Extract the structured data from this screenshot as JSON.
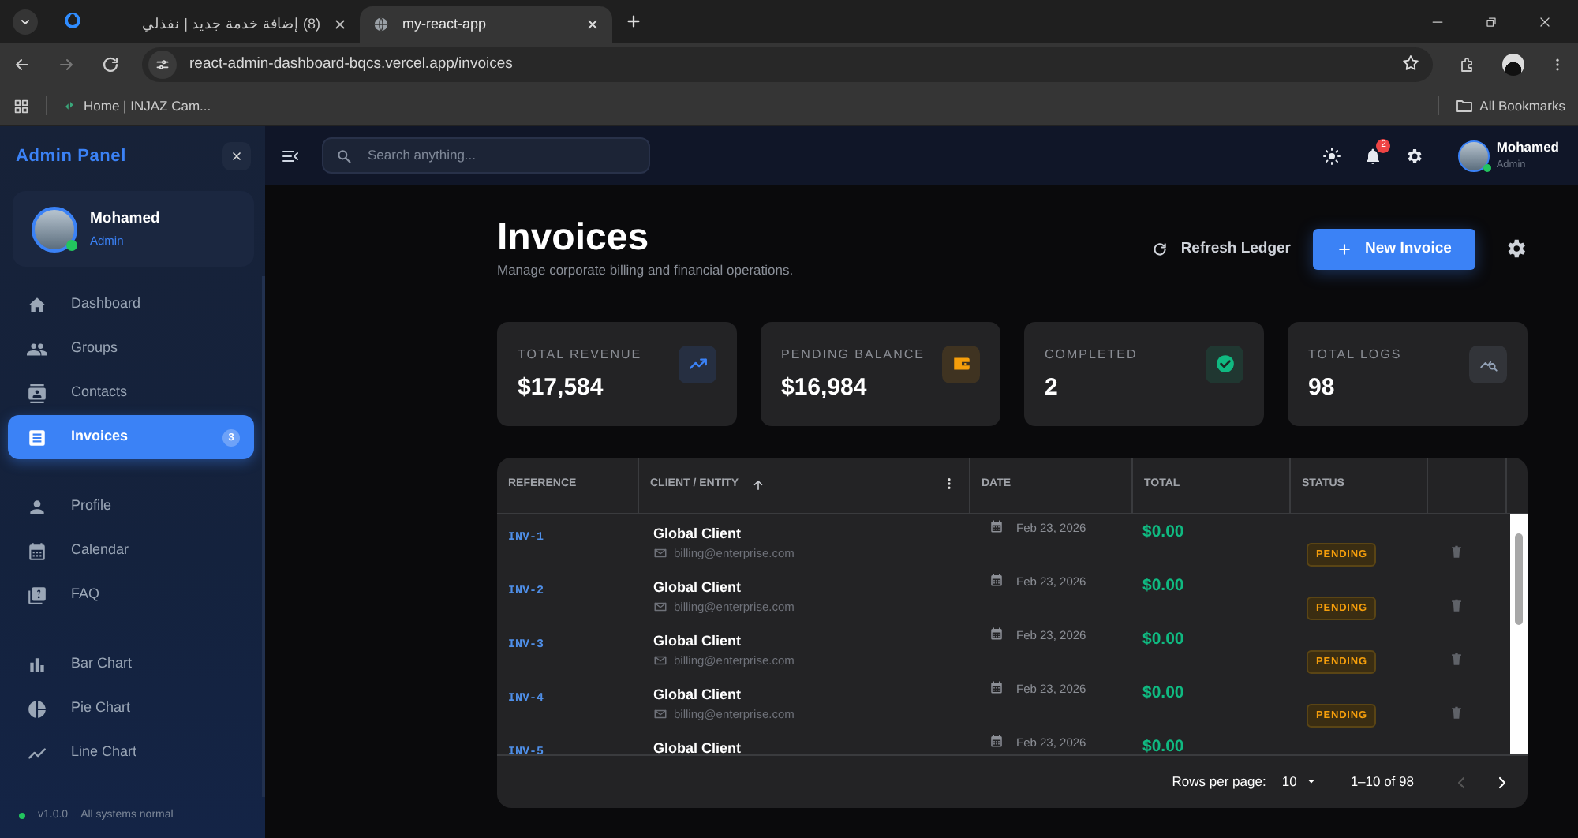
{
  "browser": {
    "tabs": [
      {
        "title": "(8) إضافة خدمة جديد | نفذلي",
        "selected": false
      },
      {
        "title": "my-react-app",
        "selected": true
      }
    ],
    "url": "react-admin-dashboard-bqcs.vercel.app/invoices",
    "bookmarks": [
      {
        "label": "Home | INJAZ Cam..."
      }
    ],
    "all_bookmarks": "All Bookmarks"
  },
  "sidebar": {
    "title": "Admin Panel",
    "user": {
      "name": "Mohamed",
      "role": "Admin",
      "online": true
    },
    "sections": [
      {
        "items": [
          {
            "label": "Dashboard",
            "selected": false
          },
          {
            "label": "Groups",
            "selected": false
          },
          {
            "label": "Contacts",
            "selected": false
          },
          {
            "label": "Invoices",
            "selected": true,
            "badge": "3"
          }
        ]
      },
      {
        "items": [
          {
            "label": "Profile",
            "selected": false
          },
          {
            "label": "Calendar",
            "selected": false
          },
          {
            "label": "FAQ",
            "selected": false
          }
        ]
      },
      {
        "items": [
          {
            "label": "Bar Chart",
            "selected": false
          },
          {
            "label": "Pie Chart",
            "selected": false
          },
          {
            "label": "Line Chart",
            "selected": false
          }
        ]
      }
    ],
    "footer": {
      "version": "v1.0.0",
      "status": "All systems normal"
    }
  },
  "topbar": {
    "search_placeholder": "Search anything...",
    "notifications": "2",
    "user": {
      "name": "Mohamed",
      "role": "Admin"
    }
  },
  "page": {
    "title": "Invoices",
    "subtitle": "Manage corporate billing and financial operations.",
    "refresh_label": "Refresh Ledger",
    "new_label": "New Invoice"
  },
  "stats": [
    {
      "label": "TOTAL REVENUE",
      "value": "$17,584",
      "color": "#3b82f6"
    },
    {
      "label": "PENDING BALANCE",
      "value": "$16,984",
      "color": "#f59e0b"
    },
    {
      "label": "COMPLETED",
      "value": "2",
      "color": "#10b981"
    },
    {
      "label": "TOTAL LOGS",
      "value": "98",
      "color": "#94a3b8"
    }
  ],
  "table": {
    "columns": [
      {
        "label": "REFERENCE",
        "sorted": false
      },
      {
        "label": "CLIENT / ENTITY",
        "sorted": true
      },
      {
        "label": "DATE",
        "sorted": false
      },
      {
        "label": "TOTAL",
        "sorted": false
      },
      {
        "label": "STATUS",
        "sorted": false
      }
    ],
    "rows": [
      {
        "reference": "INV-1",
        "client": "Global Client",
        "email": "billing@enterprise.com",
        "date": "Feb 23, 2026",
        "total": "$0.00",
        "status": "PENDING"
      },
      {
        "reference": "INV-2",
        "client": "Global Client",
        "email": "billing@enterprise.com",
        "date": "Feb 23, 2026",
        "total": "$0.00",
        "status": "PENDING"
      },
      {
        "reference": "INV-3",
        "client": "Global Client",
        "email": "billing@enterprise.com",
        "date": "Feb 23, 2026",
        "total": "$0.00",
        "status": "PENDING"
      },
      {
        "reference": "INV-4",
        "client": "Global Client",
        "email": "billing@enterprise.com",
        "date": "Feb 23, 2026",
        "total": "$0.00",
        "status": "PENDING"
      },
      {
        "reference": "INV-5",
        "client": "Global Client",
        "date": "Feb 23, 2026",
        "total": "$0.00"
      }
    ],
    "pagination": {
      "rows_per_page_label": "Rows per page:",
      "rows_per_page": "10",
      "range": "1–10 of 98",
      "prev_disabled": true
    }
  }
}
